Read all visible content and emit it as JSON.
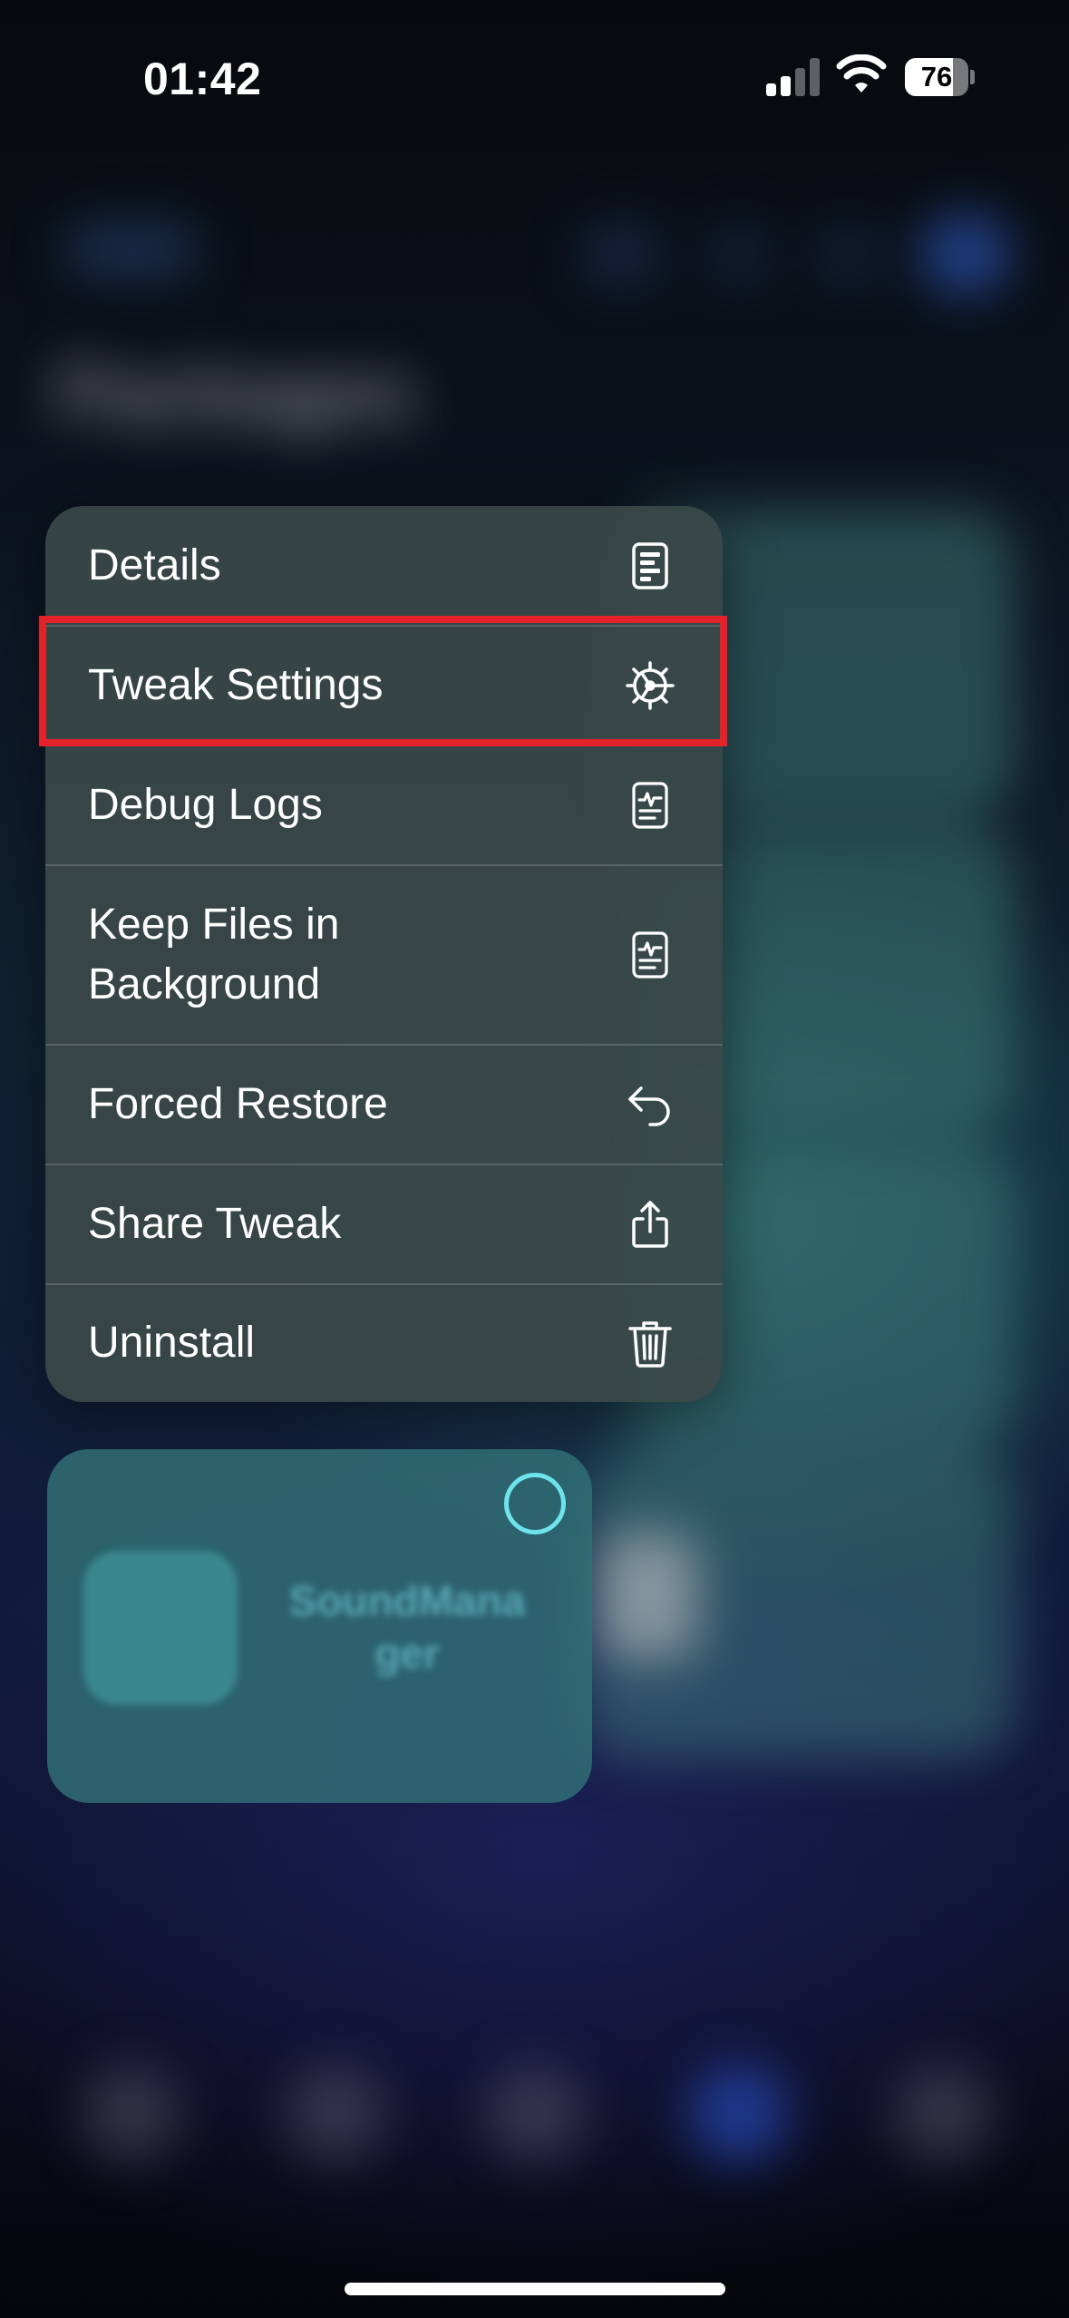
{
  "status_bar": {
    "time": "01:42",
    "battery_percent": "76",
    "battery_level": 0.76,
    "signal_bars_active": 2,
    "signal_bars_total": 4
  },
  "background_app": {
    "title": "Packages"
  },
  "context_menu": {
    "items": [
      {
        "label": "Details",
        "icon": "document-icon"
      },
      {
        "label": "Tweak Settings",
        "icon": "gear-icon"
      },
      {
        "label": "Debug Logs",
        "icon": "log-document-icon"
      },
      {
        "label": "Keep Files in Background",
        "icon": "log-document-icon"
      },
      {
        "label": "Forced Restore",
        "icon": "undo-arrow-icon"
      },
      {
        "label": "Share Tweak",
        "icon": "share-icon"
      },
      {
        "label": "Uninstall",
        "icon": "trash-icon"
      }
    ],
    "highlighted_item": "Tweak Settings",
    "highlight_color": "#e3222a"
  },
  "tweak_card": {
    "name": "SoundManager",
    "name_line1": "SoundMana",
    "name_line2": "ger",
    "selection_color": "#6fe3ec"
  }
}
